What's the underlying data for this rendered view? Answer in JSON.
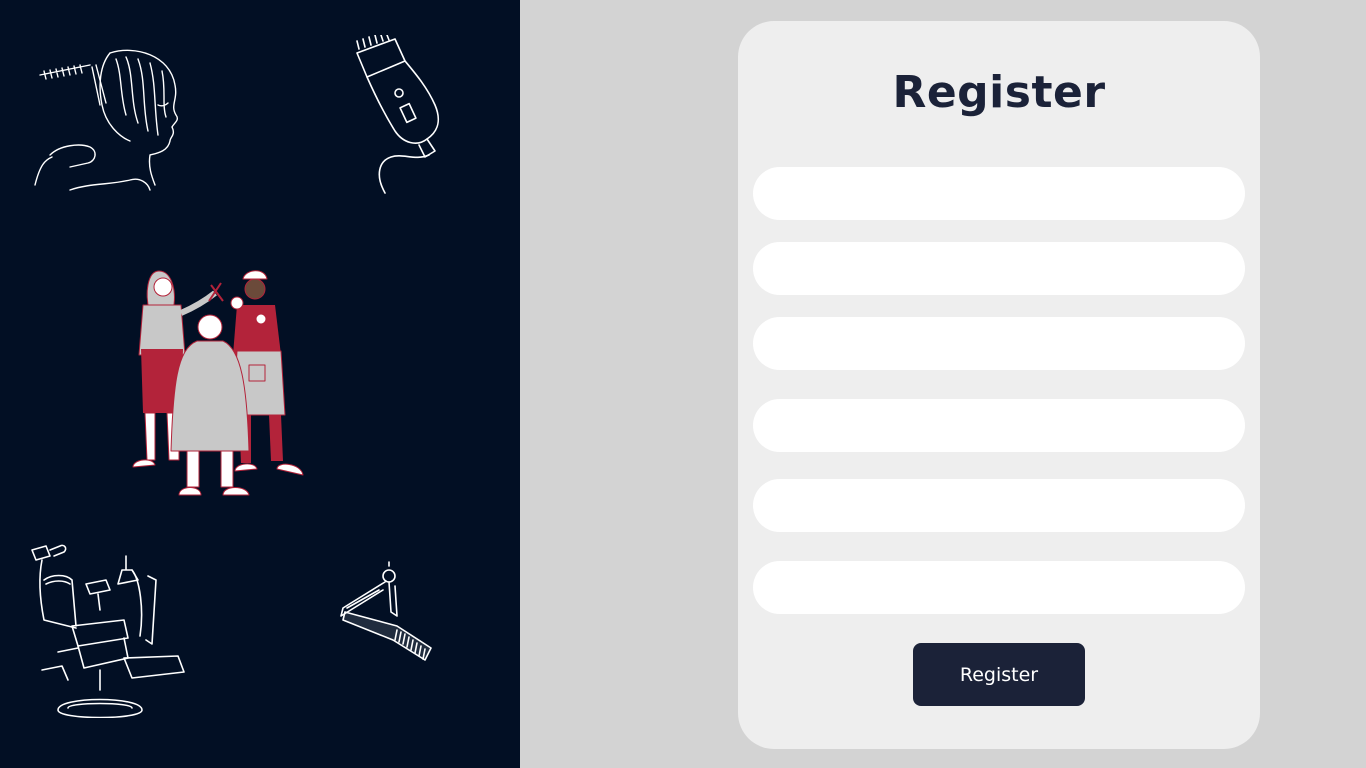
{
  "register_form": {
    "title": "Register",
    "fields": [
      {
        "value": "",
        "placeholder": ""
      },
      {
        "value": "",
        "placeholder": ""
      },
      {
        "value": "",
        "placeholder": ""
      },
      {
        "value": "",
        "placeholder": ""
      },
      {
        "value": "",
        "placeholder": ""
      },
      {
        "value": "",
        "placeholder": ""
      }
    ],
    "submit_label": "Register"
  },
  "illustrations": {
    "items": [
      "woman-haircut-sketch-icon",
      "hair-clipper-icon",
      "stylists-with-client-illustration",
      "barber-chair-icon",
      "straight-razor-comb-icon"
    ]
  },
  "colors": {
    "left_panel_bg": "#020f24",
    "page_bg": "#d3d3d3",
    "card_bg": "#eeeeee",
    "accent_dark": "#1b2238",
    "accent_red": "#b3233a"
  }
}
